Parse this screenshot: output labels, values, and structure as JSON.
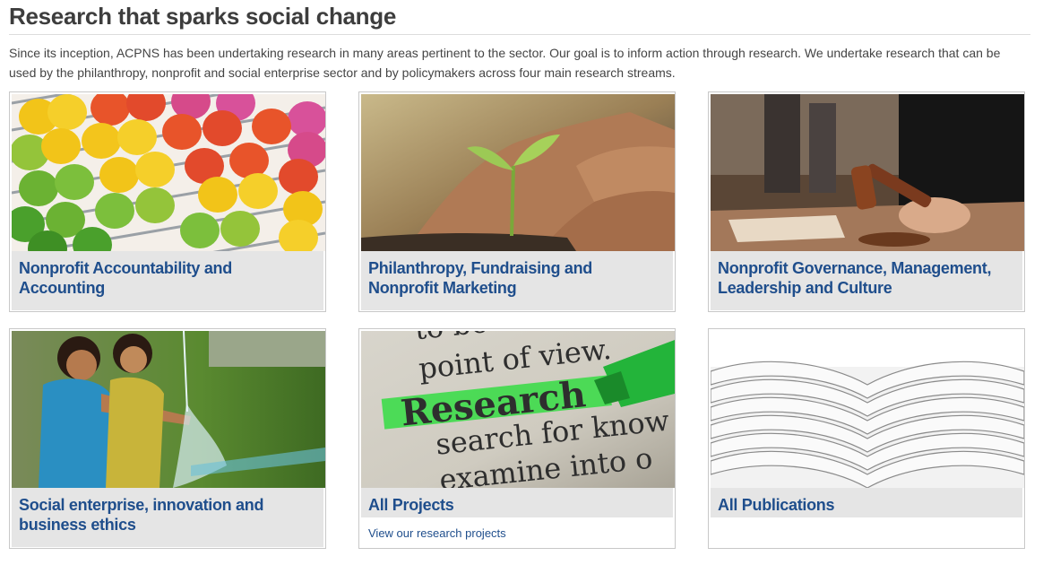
{
  "page": {
    "title": "Research that sparks social change",
    "intro": "Since its inception, ACPNS has been undertaking research in many areas pertinent to the sector. Our goal is to inform action through research. We undertake research that can be used by the philanthropy, nonprofit and social enterprise sector and by policymakers across four main research streams."
  },
  "cards": [
    {
      "title": "Nonprofit Accountability and Accounting",
      "image": "abacus-image"
    },
    {
      "title": "Philanthropy, Fundraising and Nonprofit Marketing",
      "image": "seedling-hands-image"
    },
    {
      "title": "Nonprofit Governance, Management, Leadership and Culture",
      "image": "judge-gavel-image"
    },
    {
      "title": "Social enterprise, innovation and business ethics",
      "image": "children-water-image"
    },
    {
      "title": "All Projects",
      "link": "View our research projects",
      "image": "research-highlight-image"
    },
    {
      "title": "All Publications",
      "image": "stacked-books-image"
    }
  ],
  "images": {
    "research_text": [
      "point of view.",
      "Research",
      "search for know",
      "examine into o"
    ]
  },
  "colors": {
    "link": "#1f4e8c",
    "caption_bg": "#e5e5e5",
    "highlight": "#3ddc4a"
  }
}
